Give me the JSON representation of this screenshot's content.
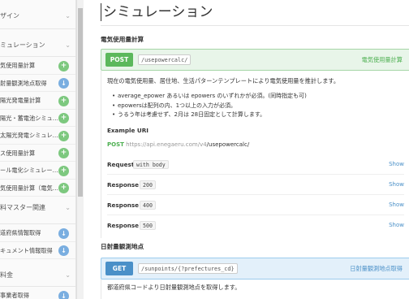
{
  "sidebar": {
    "groups": [
      {
        "label": "ザイン",
        "items": []
      },
      {
        "label": "ミュレーション",
        "items": [
          {
            "label": "気使用量計算",
            "method": "post"
          },
          {
            "label": "射量観測地点取得",
            "method": "get"
          },
          {
            "label": "陽光発電量計算",
            "method": "post"
          },
          {
            "label": "陽光・蓄電池シミュ…",
            "method": "post"
          },
          {
            "label": "太陽光発電シミュレ…",
            "method": "post"
          },
          {
            "label": "ス使用量計算",
            "method": "post"
          },
          {
            "label": "ール電化シミュレー…",
            "method": "post"
          },
          {
            "label": "気使用量計算（電気…",
            "method": "post"
          }
        ]
      },
      {
        "label": "料マスター関連",
        "items": [
          {
            "label": "道府県情報取得",
            "method": "get"
          },
          {
            "label": "キュメント情報取得",
            "method": "get"
          }
        ]
      },
      {
        "label": "料金",
        "items": [
          {
            "label": "事業者取得",
            "method": "get"
          }
        ]
      }
    ],
    "chevron": "chevron-down-icon"
  },
  "main": {
    "title": "シミュレーション",
    "op1": {
      "heading": "電気使用量計算",
      "method": "POST",
      "path": "/usepowercalc/",
      "summary": "電気使用量計算",
      "description": "現在の電気使用量、居住地、生活パターンテンプレートにより電気使用量を推計します。",
      "bullets": [
        "average_epower あるいは epowers のいずれかが必須。(同時指定も可)",
        "epowersは配列の内、1つ以上の入力が必須。",
        "うるう年は考慮せず、2月は 28日固定として計算します。"
      ],
      "example_label": "Example URI",
      "example_method": "POST",
      "example_host": "https://api.enegaeru.com/v4",
      "example_path": "/usepowercalc/",
      "request_label": "Request",
      "request_code": "with body",
      "responses": [
        {
          "label": "Response",
          "code": "200",
          "show": "Show"
        },
        {
          "label": "Response",
          "code": "400",
          "show": "Show"
        },
        {
          "label": "Response",
          "code": "500",
          "show": "Show"
        }
      ],
      "request_show": "Show"
    },
    "op2": {
      "heading": "日射量観測地点",
      "method": "GET",
      "path": "/sunpoints/{?prefectures_cd}",
      "summary": "日射量観測地点取得",
      "description": "都道府県コードより日射量観測地点を取得します。"
    }
  },
  "colors": {
    "post": "#5cb85c",
    "get": "#4a90c8",
    "post_bg": "#e8f5e9",
    "get_bg": "#e3f0fa"
  }
}
